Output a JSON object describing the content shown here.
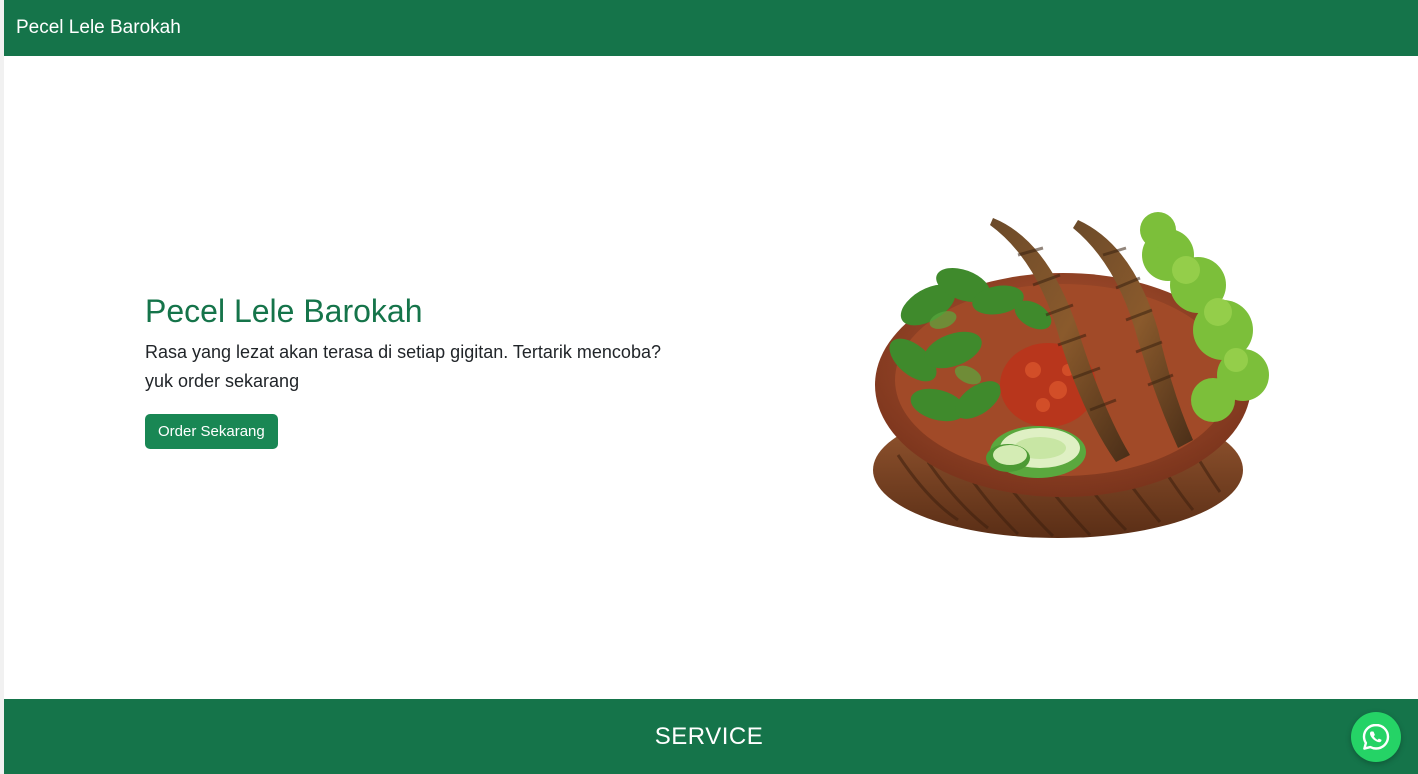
{
  "navbar": {
    "brand": "Pecel Lele Barokah"
  },
  "hero": {
    "title": "Pecel Lele Barokah",
    "description_line1": "Rasa yang lezat akan terasa di setiap gigitan. Tertarik mencoba?",
    "description_line2": "yuk order sekarang",
    "cta_label": "Order Sekarang",
    "image_icon": "pecel-lele-dish-image"
  },
  "service": {
    "title": "SERVICE"
  },
  "floating": {
    "icon": "whatsapp-icon"
  },
  "colors": {
    "primary": "#15744a",
    "button": "#198754",
    "whatsapp": "#25d366"
  }
}
